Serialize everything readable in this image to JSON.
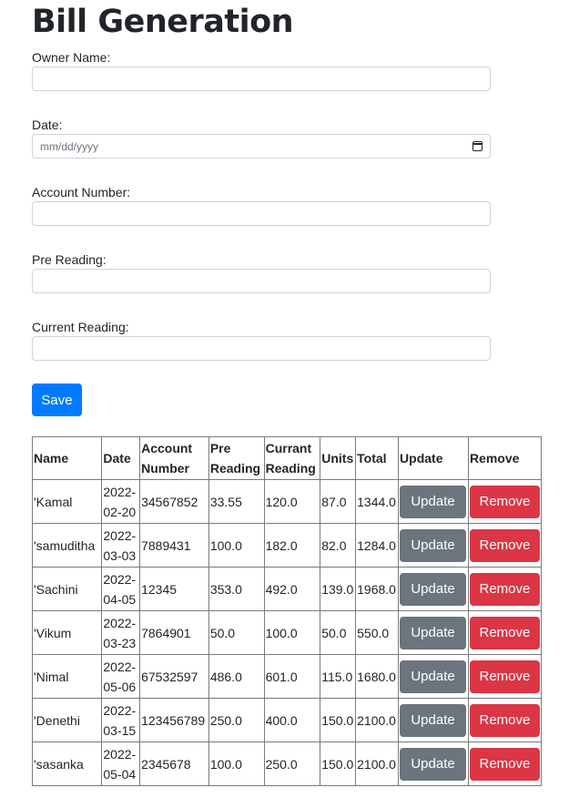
{
  "page": {
    "title": "Bill Generation"
  },
  "form": {
    "owner_label": "Owner Name:",
    "owner_value": "",
    "date_label": "Date:",
    "date_placeholder": "mm/dd/yyyy",
    "account_label": "Account Number:",
    "account_value": "",
    "pre_label": "Pre Reading:",
    "pre_value": "",
    "current_label": "Current Reading:",
    "current_value": "",
    "save_label": "Save"
  },
  "table": {
    "headers": [
      "Name",
      "Date",
      "Account Number",
      "Pre Reading",
      "Currant Reading",
      "Units",
      "Total",
      "Update",
      "Remove"
    ],
    "update_label": "Update",
    "remove_label": "Remove",
    "rows": [
      {
        "name": "'Kamal",
        "date": "2022-02-20",
        "account": "34567852",
        "pre": "33.55",
        "current": "120.0",
        "units": "87.0",
        "total": "1344.0"
      },
      {
        "name": "'samuditha",
        "date": "2022-03-03",
        "account": "7889431",
        "pre": "100.0",
        "current": "182.0",
        "units": "82.0",
        "total": "1284.0"
      },
      {
        "name": "'Sachini",
        "date": "2022-04-05",
        "account": "12345",
        "pre": "353.0",
        "current": "492.0",
        "units": "139.0",
        "total": "1968.0"
      },
      {
        "name": "'Vikum",
        "date": "2022-03-23",
        "account": "7864901",
        "pre": "50.0",
        "current": "100.0",
        "units": "50.0",
        "total": "550.0"
      },
      {
        "name": "'Nimal",
        "date": "2022-05-06",
        "account": "67532597",
        "pre": "486.0",
        "current": "601.0",
        "units": "115.0",
        "total": "1680.0"
      },
      {
        "name": "'Denethi",
        "date": "2022-03-15",
        "account": "123456789",
        "pre": "250.0",
        "current": "400.0",
        "units": "150.0",
        "total": "2100.0"
      },
      {
        "name": "'sasanka",
        "date": "2022-05-04",
        "account": "2345678",
        "pre": "100.0",
        "current": "250.0",
        "units": "150.0",
        "total": "2100.0"
      }
    ]
  }
}
